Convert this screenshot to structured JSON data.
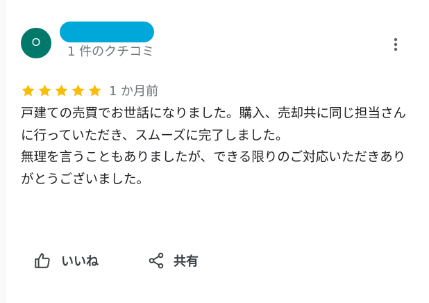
{
  "reviewer": {
    "avatar_letter": "O",
    "avatar_color": "#00796b",
    "name_redaction_color": "#00a8d9",
    "review_count": "1 件のクチコミ"
  },
  "review": {
    "rating": 5,
    "max_rating": 5,
    "star_color": "#fbbc04",
    "date": "1 か月前",
    "text": "戸建ての売買でお世話になりました。購入、売却共に同じ担当さんに行っていただき、スムーズに完了しました。\n無理を言うこともありましたが、できる限りのご対応いただきありがとうございました。"
  },
  "actions": {
    "like_label": "いいね",
    "share_label": "共有",
    "like_icon": "thumbs-up-icon",
    "share_icon": "share-icon",
    "more_icon": "more-vert-icon"
  }
}
